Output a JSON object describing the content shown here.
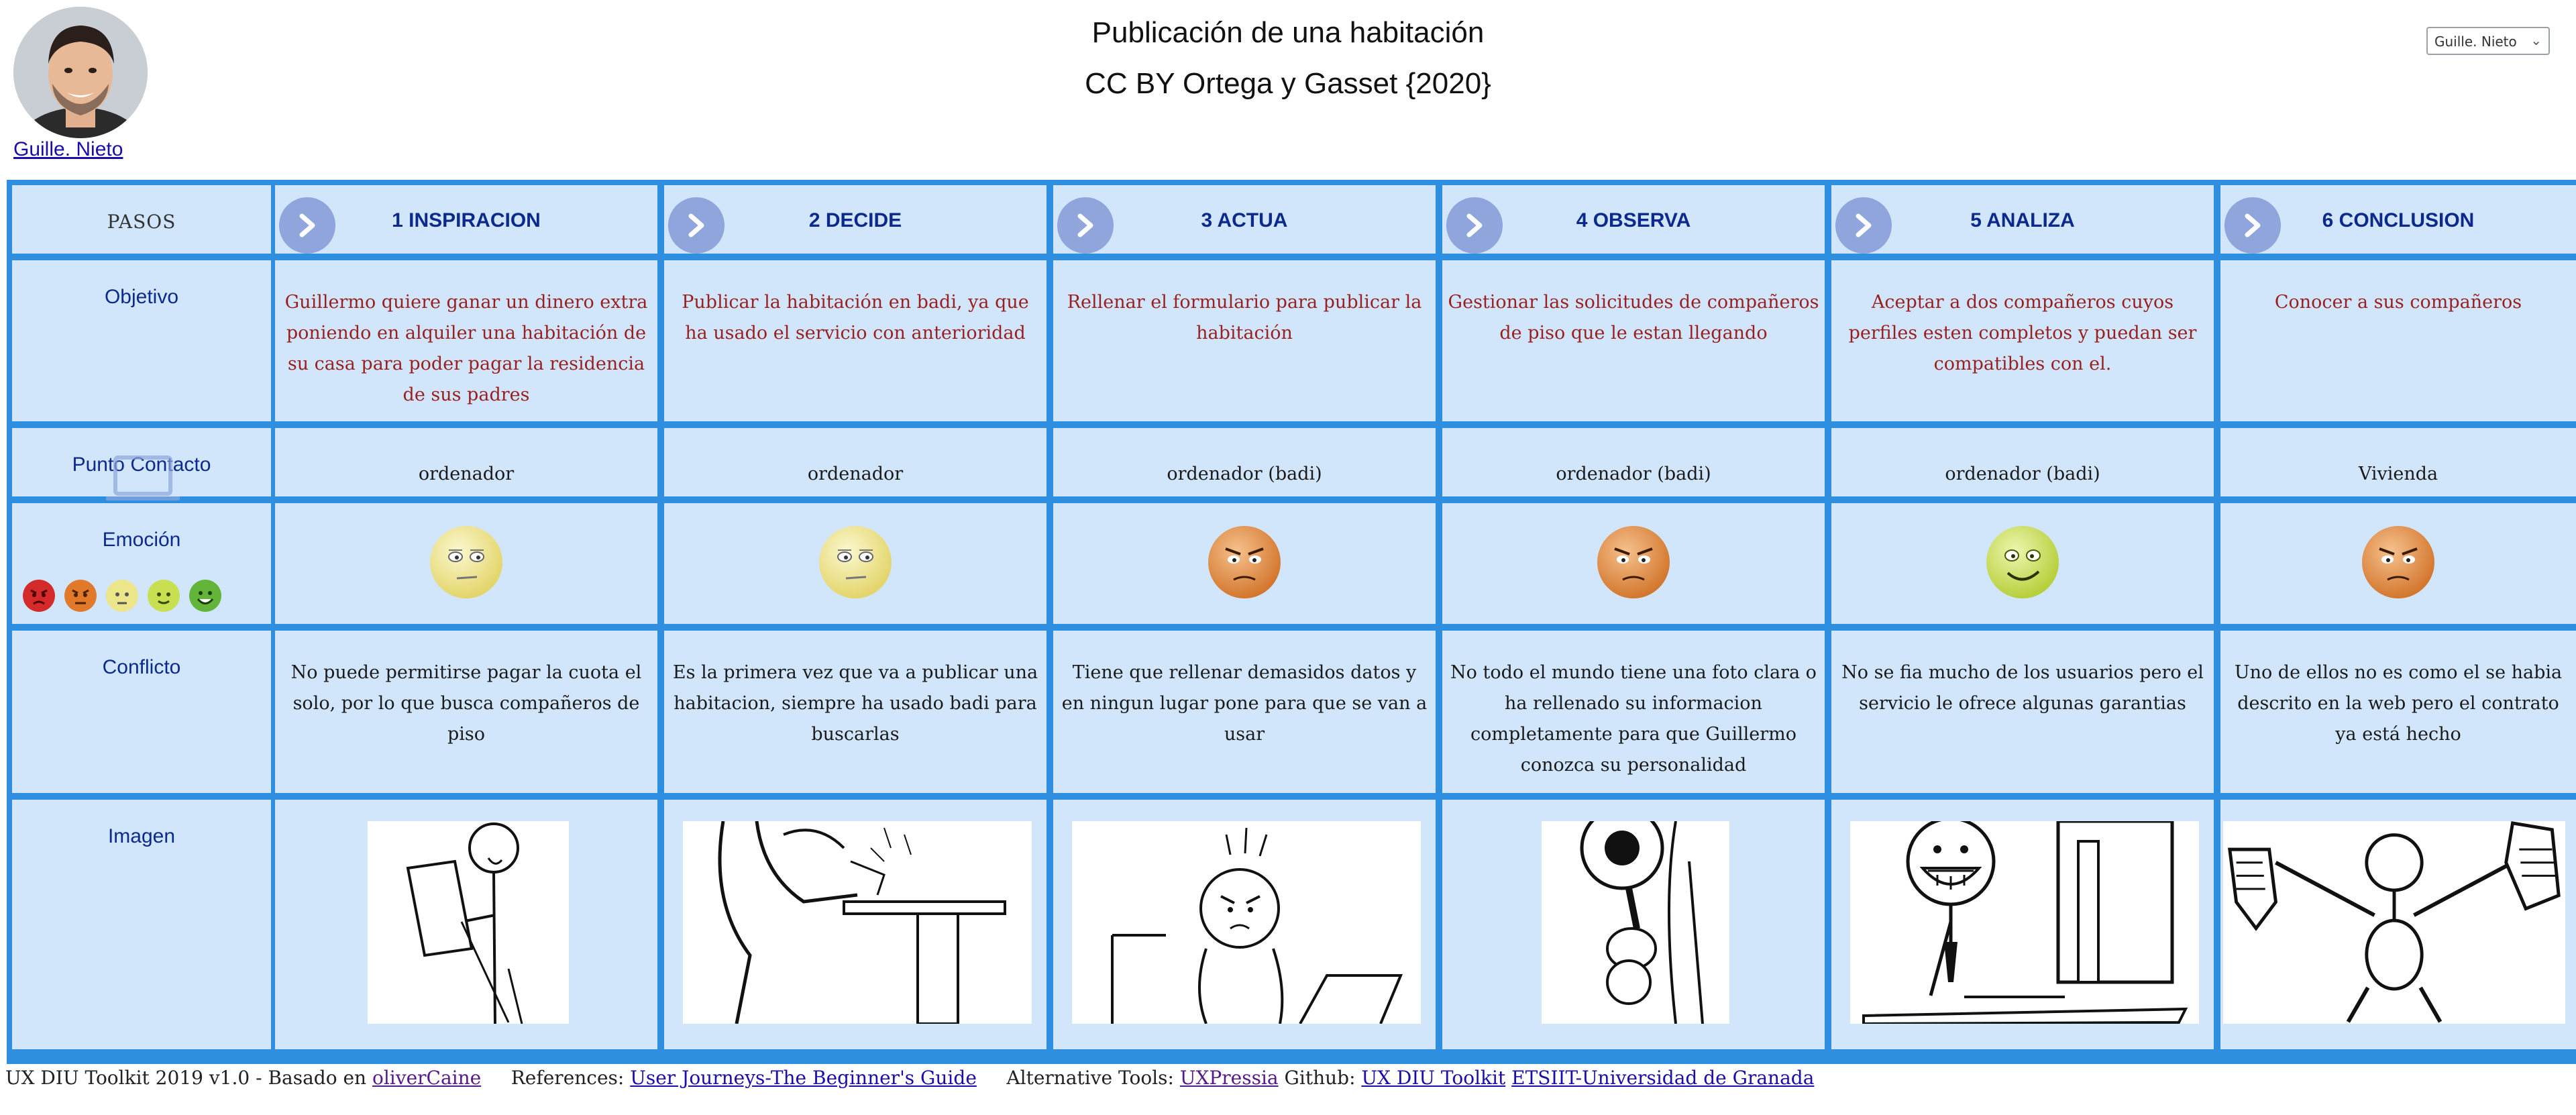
{
  "header": {
    "title": "Publicación de una habitación",
    "subtitle": "CC BY Ortega y Gasset {2020}",
    "user_link": "Guille. Nieto",
    "user_select_value": "Guille. Nieto"
  },
  "grid": {
    "corner_label": "PASOS",
    "row_labels": {
      "objetivo": "Objetivo",
      "contacto": "Punto Contacto",
      "emocion": "Emoción",
      "conflicto": "Conflicto",
      "imagen": "Imagen"
    },
    "emotion_scale": [
      "very-angry",
      "angry",
      "neutral",
      "content",
      "happy"
    ],
    "steps": [
      {
        "label": "1 INSPIRACION",
        "objetivo": "Guillermo quiere ganar un dinero extra poniendo en alquiler una habitación de su casa para poder pagar la residencia de sus padres",
        "contacto": "ordenador",
        "emotion": "neutral",
        "conflicto": "No puede permitirse pagar la cuota el solo, por lo que busca compañeros de piso",
        "imagen": "person-reading-paper"
      },
      {
        "label": "2 DECIDE",
        "objetivo": "Publicar la habitación en badi, ya que ha usado el servicio con anterioridad",
        "contacto": "ordenador",
        "emotion": "neutral",
        "conflicto": "Es la primera vez que va a publicar una habitacion, siempre ha usado badi para buscarlas",
        "imagen": "person-typing-at-desk"
      },
      {
        "label": "3 ACTUA",
        "objetivo": "Rellenar el formulario para publicar la habitación",
        "contacto": "ordenador (badi)",
        "emotion": "angry",
        "conflicto": "Tiene que rellenar demasidos datos y en ningun lugar pone para que se van a usar",
        "imagen": "frustrated-person-laptop"
      },
      {
        "label": "4 OBSERVA",
        "objetivo": "Gestionar las solicitudes de compañeros de piso que le estan llegando",
        "contacto": "ordenador (badi)",
        "emotion": "angry",
        "conflicto": "No todo el mundo tiene una foto clara o ha rellenado su informacion completamente para que Guillermo conozca su personalidad",
        "imagen": "person-with-magnifier"
      },
      {
        "label": "5 ANALIZA",
        "objetivo": "Aceptar a dos compañeros cuyos perfiles esten completos y puedan ser compatibles con el.",
        "contacto": "ordenador (badi)",
        "emotion": "content",
        "conflicto": "No se fia mucho de los usuarios pero el servicio le ofrece algunas garantias",
        "imagen": "smiling-person-computer"
      },
      {
        "label": "6 CONCLUSION",
        "objetivo": "Conocer a sus compañeros",
        "contacto": "Vivienda",
        "emotion": "angry",
        "conflicto": "Uno de ellos no es como el se habia descrito en la web pero el contrato ya está hecho",
        "imagen": "person-thumbs-down"
      }
    ]
  },
  "footer": {
    "credit_text": "UX DIU Toolkit 2019 v1.0 - Basado en",
    "credit_link": "oliverCaine",
    "references_label": "References:",
    "references_link": "User Journeys-The Beginner's Guide",
    "alt_tools_label": "Alternative Tools:",
    "alt_tools_link": "UXPressia",
    "github_label": "Github:",
    "github_link": "UX DIU Toolkit",
    "university_link": "ETSIIT-Universidad de Granada"
  },
  "colors": {
    "grid_border": "#2e8fe0",
    "cell_bg": "#d1e6fb",
    "objective_text": "#9a1f1f",
    "heading_text": "#0b2a8c",
    "arrow_bg": "#8fa5dc",
    "link": "#1a0dab"
  }
}
